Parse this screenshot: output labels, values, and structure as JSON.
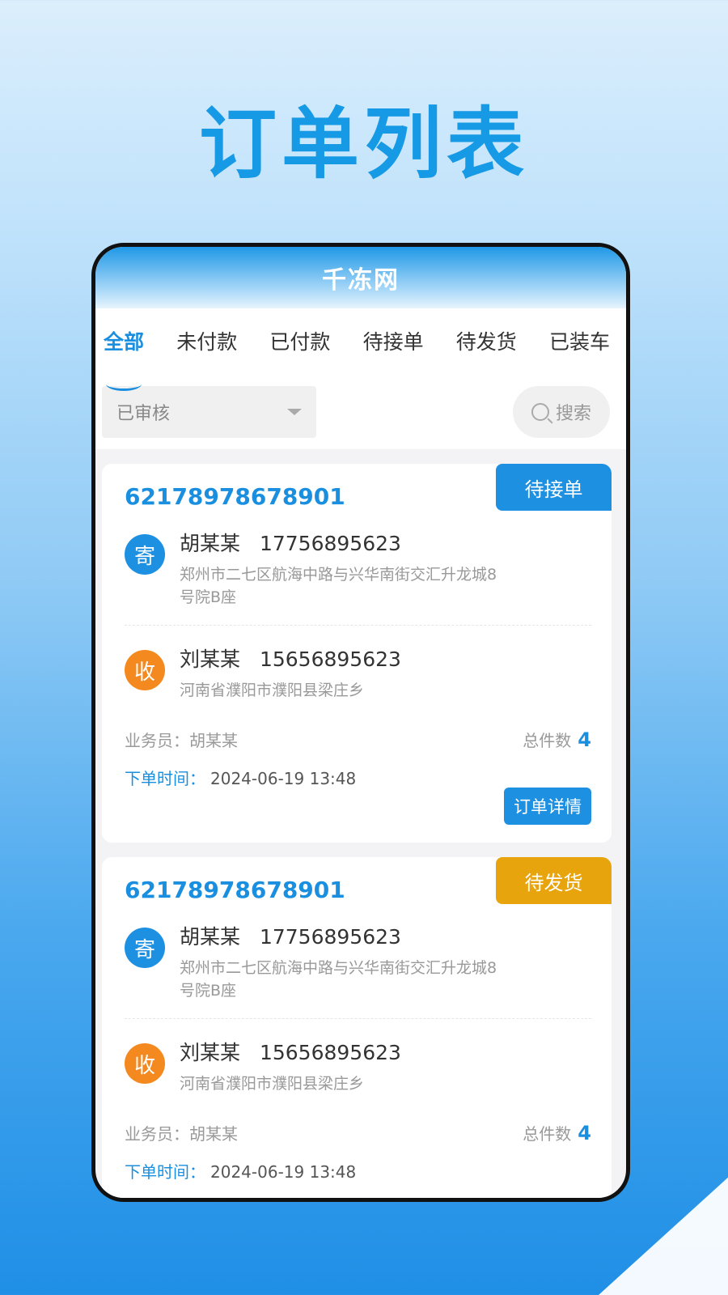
{
  "hero_title": "订单列表",
  "app": {
    "title": "千冻网"
  },
  "tabs": [
    {
      "label": "全部"
    },
    {
      "label": "未付款"
    },
    {
      "label": "已付款"
    },
    {
      "label": "待接单"
    },
    {
      "label": "待发货"
    },
    {
      "label": "已装车"
    }
  ],
  "filter": {
    "selected": "已审核",
    "search_label": "搜索"
  },
  "orders": [
    {
      "order_no": "62178978678901",
      "status": "待接单",
      "status_color": "#1d90e2",
      "sender": {
        "badge": "寄",
        "name": "胡某某",
        "phone": "17756895623",
        "address": "郑州市二七区航海中路与兴华南街交汇升龙城8号院B座"
      },
      "receiver": {
        "badge": "收",
        "name": "刘某某",
        "phone": "15656895623",
        "address": "河南省濮阳市濮阳县梁庄乡"
      },
      "salesman_label": "业务员：胡某某",
      "count_label": "总件数",
      "count": "4",
      "time_label": "下单时间：",
      "time": "2024-06-19 13:48",
      "detail_label": "订单详情"
    },
    {
      "order_no": "62178978678901",
      "status": "待发货",
      "status_color": "#e8a40c",
      "sender": {
        "badge": "寄",
        "name": "胡某某",
        "phone": "17756895623",
        "address": "郑州市二七区航海中路与兴华南街交汇升龙城8号院B座"
      },
      "receiver": {
        "badge": "收",
        "name": "刘某某",
        "phone": "15656895623",
        "address": "河南省濮阳市濮阳县梁庄乡"
      },
      "salesman_label": "业务员：胡某某",
      "count_label": "总件数",
      "count": "4",
      "time_label": "下单时间：",
      "time": "2024-06-19 13:48"
    }
  ]
}
